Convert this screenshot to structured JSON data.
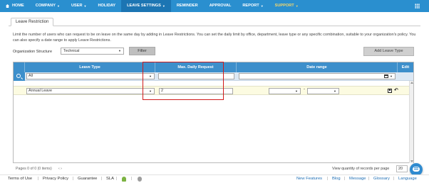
{
  "nav": {
    "items": [
      {
        "label": "HOME",
        "caret": false,
        "icon": "home-icon"
      },
      {
        "label": "COMPANY",
        "caret": true
      },
      {
        "label": "USER",
        "caret": true
      },
      {
        "label": "HOLIDAY",
        "caret": false
      },
      {
        "label": "LEAVE SETTINGS",
        "caret": true,
        "active": true
      },
      {
        "label": "REMINDER",
        "caret": false
      },
      {
        "label": "APPROVAL",
        "caret": false
      },
      {
        "label": "REPORT",
        "caret": true
      },
      {
        "label": "SUPPORT",
        "caret": true,
        "color": "#f6d76a"
      }
    ],
    "background": "#2a8fcf",
    "active_background": "#1c75b3"
  },
  "tab": {
    "label": "Leave Restriction"
  },
  "description": "Limit the number of users who can request to be on leave on the same day by adding in Leave Restrictions. You can set the daily limit by office, department, leave type or any specific combination, suitable to your organization's policy. You can also specify a date range to apply Leave Restrictions.",
  "filter": {
    "org_label": "Organization Structure",
    "org_value": "Technical",
    "filter_button": "Filter",
    "add_button": "Add Leave Type"
  },
  "grid": {
    "columns": [
      "Leave Type",
      "Max. Daily Request",
      "Date range",
      "Edit"
    ],
    "filter_row": {
      "leave_type": "All",
      "max_daily": "",
      "date_range": ""
    },
    "rows": [
      {
        "leave_type": "Annual Leave",
        "max_daily": "2",
        "date_from": "",
        "date_to": "",
        "separator": "-"
      }
    ],
    "header_color": "#3d8fcb",
    "row_highlight": "#fcfbe1",
    "annotation_color": "#d11a1a"
  },
  "pager": {
    "info": "Pages 0 of 0 (0 items)",
    "nav": "‹ ›"
  },
  "view_quantity": {
    "label": "View quantity of records per page",
    "value": "20"
  },
  "footer": {
    "left": [
      "Terms of Use",
      "Privacy Policy",
      "Guarantee",
      "SLA"
    ],
    "right": [
      "New Features",
      "Blog",
      "Message",
      "Glossary",
      "Language"
    ],
    "separator": "|"
  }
}
